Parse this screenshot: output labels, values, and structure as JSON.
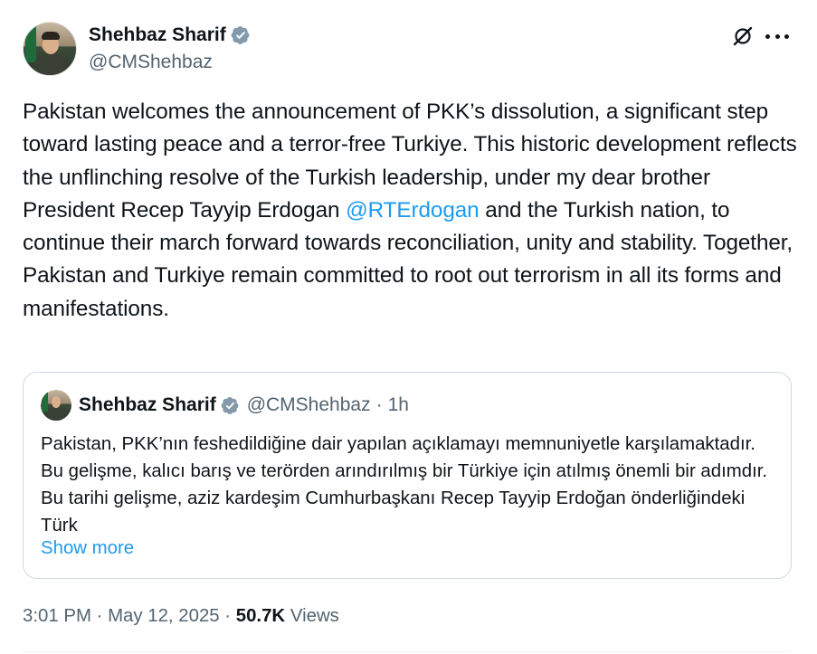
{
  "author": {
    "name": "Shehbaz Sharif",
    "handle": "@CMShehbaz"
  },
  "tweet": {
    "text_before_mention": "Pakistan welcomes the announcement of PKK’s dissolution, a significant step toward lasting peace and a terror-free Turkiye. This historic development reflects the unflinching resolve of the Turkish leadership, under my dear brother President Recep Tayyip Erdogan ",
    "mention": "@RTErdogan",
    "text_after_mention": " and the Turkish nation, to continue their march forward towards reconciliation, unity and stability. Together, Pakistan and Turkiye remain committed to root out terrorism in all its forms and manifestations."
  },
  "quote": {
    "name": "Shehbaz Sharif",
    "handle": "@CMShehbaz",
    "separator": "·",
    "time": "1h",
    "text": "Pakistan, PKK’nın feshedildiğine dair yapılan açıklamayı memnuniyetle karşılamaktadır. Bu gelişme, kalıcı barış ve terörden arındırılmış bir Türkiye için atılmış önemli bir adımdır. Bu tarihi gelişme, aziz kardeşim Cumhurbaşkanı Recep Tayyip Erdoğan önderliğindeki Türk",
    "show_more": "Show more"
  },
  "meta": {
    "time": "3:01 PM",
    "sep1": " · ",
    "date": "May 12, 2025",
    "sep2": " · ",
    "views_count": "50.7K",
    "views_label": " Views"
  },
  "colors": {
    "accent": "#1d9bf0",
    "secondary_text": "#536471",
    "border": "#cfd9de"
  },
  "icons": {
    "verified": "verified-badge-icon",
    "grok": "grok-icon",
    "more": "more-options-icon"
  }
}
